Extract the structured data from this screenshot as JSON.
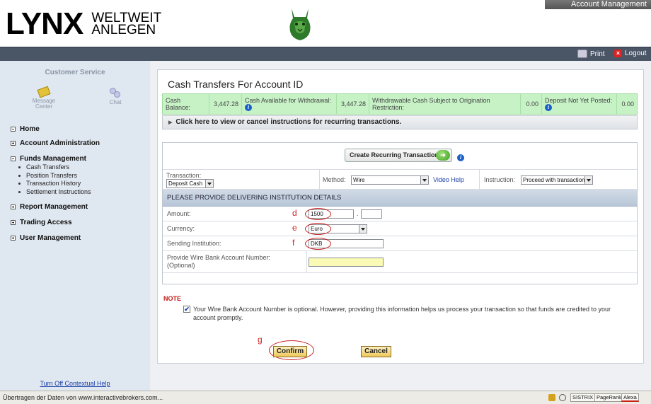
{
  "header": {
    "brand": "LYNX",
    "tagline_line1": "WELTWEIT",
    "tagline_line2": "ANLEGEN",
    "account_management": "Account Management",
    "print": "Print",
    "logout": "Logout"
  },
  "sidebar": {
    "customer_service": "Customer Service",
    "message_center": "Message Center",
    "chat": "Chat",
    "nav": {
      "home": "Home",
      "account_administration": "Account Administration",
      "funds_management": "Funds Management",
      "funds_sub": [
        "Cash Transfers",
        "Position Transfers",
        "Transaction History",
        "Settlement Instructions"
      ],
      "report_management": "Report Management",
      "trading_access": "Trading Access",
      "user_management": "User Management"
    },
    "contextual_help": "Turn Off Contextual Help"
  },
  "main": {
    "title": "Cash Transfers For Account ID",
    "balances": {
      "cash_balance_label": "Cash Balance:",
      "cash_balance_value": "3,447.28",
      "cash_available_label": "Cash Available for Withdrawal:",
      "cash_available_value": "3,447.28",
      "withdrawable_label": "Withdrawable Cash Subject to Origination Restriction:",
      "withdrawable_value": "0.00",
      "deposit_label": "Deposit Not Yet Posted:",
      "deposit_value": "0.00"
    },
    "recurring_link": "Click here to view or cancel instructions for recurring transactions.",
    "create_recurring": "Create Recurring Transaction",
    "transaction_label": "Transaction:",
    "transaction_value": "Deposit Cash",
    "method_label": "Method:",
    "method_value": "Wire",
    "video_help": "Video Help",
    "instruction_label": "Instruction:",
    "instruction_value": "Proceed with transaction",
    "section_header": "PLEASE PROVIDE DELIVERING INSTITUTION DETAILS",
    "amount_label": "Amount:",
    "amount_value": "1500",
    "amount_decimal": "",
    "currency_label": "Currency:",
    "currency_value": "Euro",
    "sending_label": "Sending Institution:",
    "sending_value": "DKB",
    "wire_label_line1": "Provide Wire Bank Account Number:",
    "wire_label_line2": "(Optional)",
    "wire_value": "",
    "markers": {
      "d": "d",
      "e": "e",
      "f": "f",
      "g": "g"
    },
    "note_title": "NOTE",
    "note_text": "Your Wire Bank Account Number is optional. However, providing this information helps us process your transaction so that funds are credited to your account promptly.",
    "note_checked": true,
    "confirm": "Confirm",
    "cancel": "Cancel"
  },
  "statusbar": {
    "text": "Übertragen der Daten von www.interactivebrokers.com...",
    "sistrix": "SISTRIX",
    "pagerank": "PageRank",
    "alexa": "Alexa"
  },
  "colors": {
    "topbar": "#4a5566",
    "sidebar_bg": "#dfe7f0",
    "balance_bg": "#c6f2c6",
    "marker_red": "#c81e1e",
    "button_gold": "#efc85a"
  }
}
